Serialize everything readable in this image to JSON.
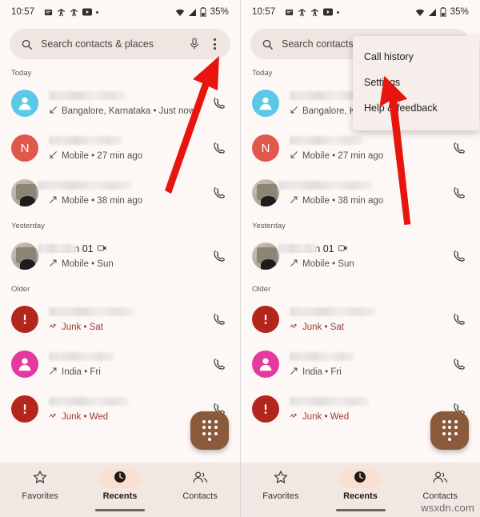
{
  "statusbar": {
    "time": "10:57",
    "battery": "35%",
    "icons": [
      "calendar-icon",
      "person-walk-icon",
      "person-walk-icon",
      "youtube-icon",
      "dot-icon"
    ],
    "right_icons": [
      "wifi-icon",
      "signal-icon",
      "battery-icon"
    ]
  },
  "search": {
    "placeholder": "Search contacts & places",
    "placeholder_short": "Search contact",
    "search_icon": "search-icon",
    "mic_icon": "microphone-icon",
    "overflow_icon": "kebab-menu-icon"
  },
  "menu": {
    "items": [
      {
        "label": "Call history"
      },
      {
        "label": "Settings"
      },
      {
        "label": "Help & feedback"
      }
    ]
  },
  "sections": {
    "today": "Today",
    "yesterday": "Yesterday",
    "older": "Older"
  },
  "calls": [
    {
      "section": "Today",
      "name": "",
      "name_blurred": true,
      "blur_width": 96,
      "avatar": {
        "kind": "person",
        "color": "#5cc8e8",
        "initial": ""
      },
      "direction": "incoming",
      "detail": "Bangalore, Karnataka • Just now",
      "detail_short": "Bangalore, K",
      "junk": false,
      "video": false,
      "call_icon": "phone-call-icon"
    },
    {
      "section": "Today",
      "name": "",
      "name_blurred": true,
      "blur_width": 92,
      "avatar": {
        "kind": "letter",
        "color": "#e0584c",
        "initial": "N"
      },
      "direction": "incoming",
      "detail": "Mobile • 27 min ago",
      "detail_short": "Mobile • 27 min ago",
      "junk": false,
      "video": false,
      "call_icon": "phone-call-icon"
    },
    {
      "section": "Today",
      "name": "",
      "name_blurred": true,
      "blur_width": 118,
      "avatar": {
        "kind": "photo",
        "color": "#9b9486",
        "initial": ""
      },
      "direction": "outgoing",
      "detail": "Mobile • 38 min ago",
      "detail_short": "Mobile • 38 min ago",
      "junk": false,
      "video": false,
      "call_icon": "phone-call-icon"
    },
    {
      "section": "Yesterday",
      "name": "manan 01",
      "name_blurred": false,
      "blur_width": 48,
      "avatar": {
        "kind": "photo",
        "color": "#9b9486",
        "initial": ""
      },
      "direction": "outgoing",
      "detail": "Mobile • Sun",
      "detail_short": "Mobile • Sun",
      "junk": false,
      "video": true,
      "call_icon": "phone-call-icon"
    },
    {
      "section": "Older",
      "name": "",
      "name_blurred": true,
      "blur_width": 108,
      "avatar": {
        "kind": "alert",
        "color": "#b3261e",
        "initial": ""
      },
      "direction": "missed-junk",
      "detail": "Junk • Sat",
      "detail_short": "Junk • Sat",
      "junk": true,
      "video": false,
      "call_icon": "phone-call-icon"
    },
    {
      "section": "Older",
      "name": "",
      "name_blurred": true,
      "blur_width": 82,
      "avatar": {
        "kind": "person",
        "color": "#e4399f",
        "initial": ""
      },
      "direction": "outgoing",
      "detail": "India • Fri",
      "detail_short": "India • Fri",
      "junk": false,
      "video": false,
      "call_icon": "phone-call-icon"
    },
    {
      "section": "Older",
      "name": "",
      "name_blurred": true,
      "blur_width": 100,
      "avatar": {
        "kind": "alert",
        "color": "#b3261e",
        "initial": ""
      },
      "direction": "missed-junk",
      "detail": "Junk • Wed",
      "detail_short": "Junk • Wed",
      "junk": true,
      "video": false,
      "call_icon": "phone-call-icon"
    }
  ],
  "fab": {
    "icon": "dialpad-icon"
  },
  "bottomnav": {
    "items": [
      {
        "label": "Favorites",
        "icon": "star-icon",
        "active": false
      },
      {
        "label": "Recents",
        "icon": "clock-icon",
        "active": true
      },
      {
        "label": "Contacts",
        "icon": "contacts-icon",
        "active": false
      }
    ]
  },
  "annotation": {
    "arrow_color": "#e8150f"
  },
  "watermark": {
    "text": "wsxdn.com"
  },
  "colors": {
    "background": "#fdf8f6",
    "searchbar": "#efe6e2",
    "navbar": "#f3e7e4",
    "active_pill": "#f9ded2",
    "fab": "#8a5a3b",
    "junk_text": "#9b3b33",
    "menu_bg": "#f6eeeb"
  }
}
